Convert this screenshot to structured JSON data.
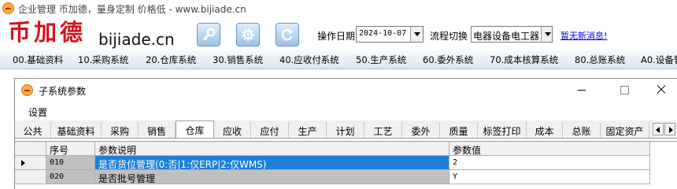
{
  "app": {
    "title": "企业管理 币加德，量身定制 价格低 - www.bijiade.cn",
    "brand_cn": "币加德",
    "brand_en": "bijiade.cn"
  },
  "toolbar": {
    "buttons": [
      {
        "icon": "key-icon"
      },
      {
        "icon": "gear-icon"
      },
      {
        "icon": "refresh-icon"
      }
    ],
    "op_date_label": "操作日期",
    "op_date_value": "2024-10-07",
    "flow_label": "流程切换",
    "flow_value": "电器设备电工器",
    "messages_link": "暂无新消息!"
  },
  "module_menu": [
    "00.基础资料",
    "10.采购系统",
    "20.仓库系统",
    "30.销售系统",
    "40.应收付系统",
    "50.生产系统",
    "60.委外系统",
    "70.成本核算系统",
    "80.总账系统",
    "A0.设备管"
  ],
  "child_window": {
    "title": "子系统参数",
    "menu": [
      "设置"
    ],
    "tabs": [
      "公共",
      "基础资料",
      "采购",
      "销售",
      "仓库",
      "应收",
      "应付",
      "生产",
      "计划",
      "工艺",
      "委外",
      "质量",
      "标签打印",
      "成本",
      "总账",
      "固定资产"
    ],
    "active_tab": "仓库",
    "grid": {
      "columns": [
        "序号",
        "参数说明",
        "参数值"
      ],
      "rows": [
        {
          "seq": "010",
          "desc": "是否货位管理(0:否|1:仅ERP|2:仅WMS)",
          "value": "2",
          "selected": true
        },
        {
          "seq": "020",
          "desc": "是否批号管理",
          "value": "Y",
          "selected": false
        }
      ]
    }
  },
  "colors": {
    "brand_red": "#d4141c",
    "selection_blue": "#1e7fd8",
    "link_blue": "#0000ee"
  }
}
